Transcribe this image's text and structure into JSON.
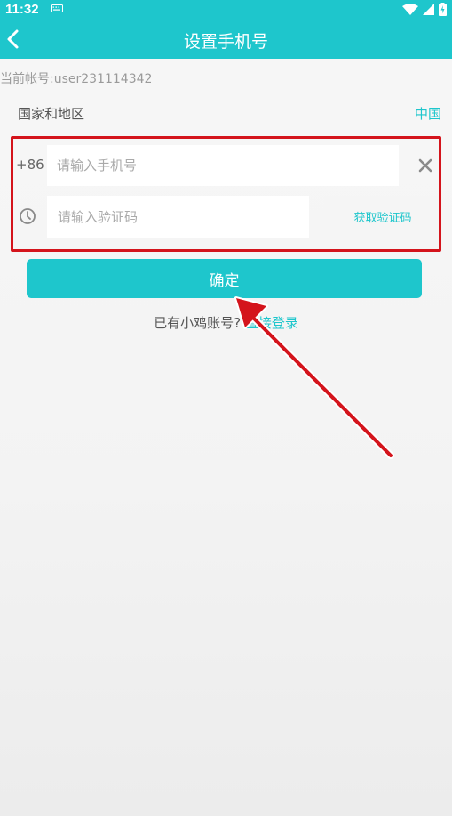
{
  "status_bar": {
    "time": "11:32"
  },
  "app_bar": {
    "title": "设置手机号"
  },
  "account": {
    "text": "当前帐号:user231114342"
  },
  "region": {
    "label": "国家和地区",
    "value": "中国"
  },
  "phone": {
    "prefix": "+86",
    "placeholder": "请输入手机号"
  },
  "code": {
    "placeholder": "请输入验证码",
    "get_code_label": "获取验证码"
  },
  "confirm": {
    "label": "确定"
  },
  "login": {
    "question": "已有小鸡账号?",
    "link": "直接登录"
  },
  "colors": {
    "accent": "#1ec6cc",
    "annotation": "#d4141c"
  }
}
